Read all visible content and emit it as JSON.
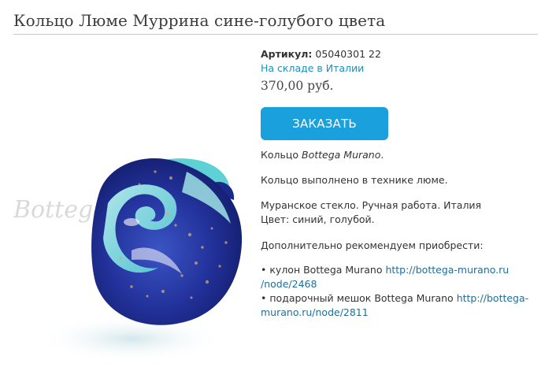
{
  "page": {
    "title": "Кольцо Люме Муррина сине-голубого цвета"
  },
  "product": {
    "image_watermark": "BottegaMurano",
    "sku_label": "Артикул:",
    "sku_value": "05040301 22",
    "stock_status": "На складе в Италии",
    "price": "370,00 руб.",
    "order_button": "ЗАКАЗАТЬ",
    "desc_line1_prefix": "Кольцо ",
    "desc_line1_brand": "Bottega Murano",
    "desc_line1_suffix": ".",
    "desc_technique": "Кольцо выполнено в технике люме.",
    "desc_origin": "Муранское стекло. Ручная работа. Италия",
    "desc_color": "Цвет:  синий, голубой.",
    "recommend_heading": "Дополнительно рекомендуем приобрести:",
    "recommendations": [
      {
        "bullet": "•",
        "text": "кулон Bottega Murano",
        "link_line1": "http://bottega-murano.ru",
        "link_line2": "/node/2468"
      },
      {
        "bullet": "•",
        "text": "подарочный мешок Bottega Murano",
        "link_line1": "http://bottega-",
        "link_line2": "murano.ru/node/2811"
      }
    ]
  },
  "colors": {
    "accent_button": "#1aa0dc",
    "link": "#1f6e9a",
    "stock": "#1f8fb8"
  }
}
